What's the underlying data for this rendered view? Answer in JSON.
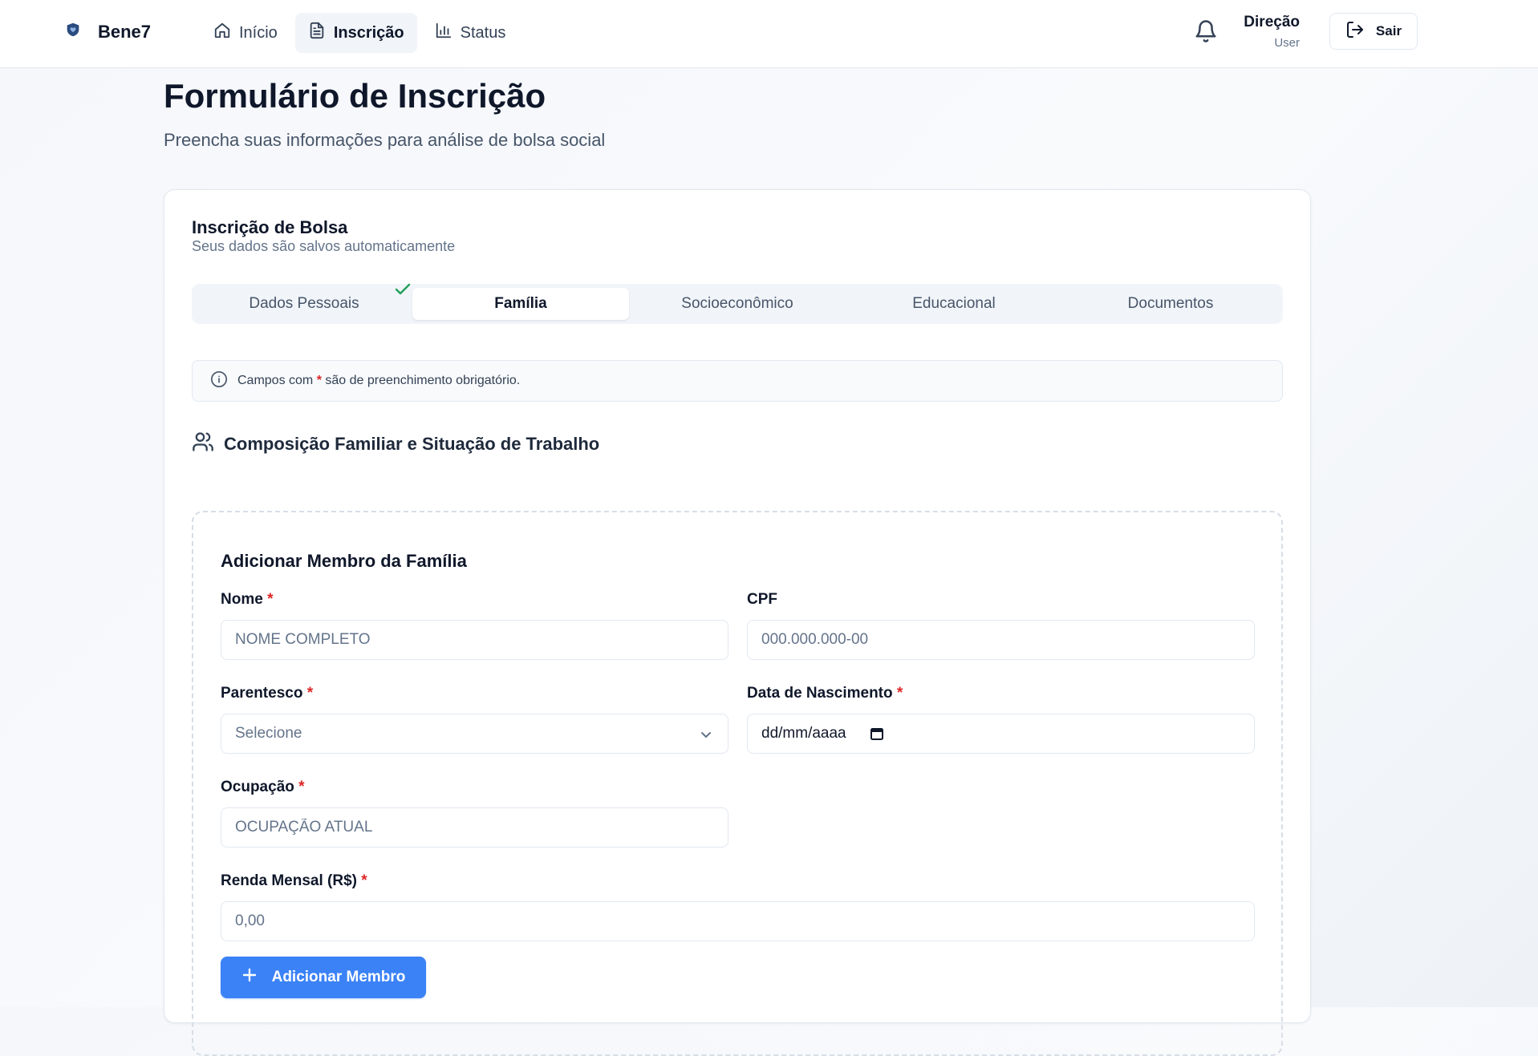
{
  "brand": {
    "name": "Bene7",
    "icon": "heart-shield-icon"
  },
  "nav": {
    "items": [
      {
        "label": "Início",
        "icon": "home-icon",
        "active": false
      },
      {
        "label": "Inscrição",
        "icon": "file-text-icon",
        "active": true
      },
      {
        "label": "Status",
        "icon": "bar-chart-icon",
        "active": false
      }
    ]
  },
  "header": {
    "notifications_icon": "bell-icon",
    "user_name": "Direção",
    "user_role": "User",
    "logout_label": "Sair"
  },
  "page": {
    "title": "Formulário de Inscrição",
    "subtitle": "Preencha suas informações para análise de bolsa social"
  },
  "card": {
    "title": "Inscrição de Bolsa",
    "description": "Seus dados são salvos automaticamente",
    "tabs": [
      {
        "label": "Dados Pessoais",
        "completed": true
      },
      {
        "label": "Família",
        "active": true
      },
      {
        "label": "Socioeconômico"
      },
      {
        "label": "Educacional"
      },
      {
        "label": "Documentos"
      }
    ],
    "notice": {
      "before": "Campos com",
      "marker": "*",
      "after": "são de preenchimento obrigatório."
    },
    "section_title": "Composição Familiar e Situação de Trabalho"
  },
  "member_form": {
    "title": "Adicionar Membro da Família",
    "required_marker": "*",
    "name": {
      "label": "Nome",
      "placeholder": "NOME COMPLETO"
    },
    "cpf": {
      "label": "CPF",
      "placeholder": "000.000.000-00"
    },
    "relationship": {
      "label": "Parentesco",
      "value": "Selecione"
    },
    "birth_date": {
      "label": "Data de Nascimento",
      "value": "dd/mm/aaaa"
    },
    "occupation": {
      "label": "Ocupação",
      "placeholder": "OCUPAÇÃO ATUAL"
    },
    "income": {
      "label": "Renda Mensal (R$)",
      "placeholder": "0,00"
    },
    "add_button": "Adicionar Membro"
  },
  "colors": {
    "primary": "#3b82f6",
    "required": "#dc2626",
    "success": "#22a05a",
    "brand_icon": "#2b4c7e"
  }
}
